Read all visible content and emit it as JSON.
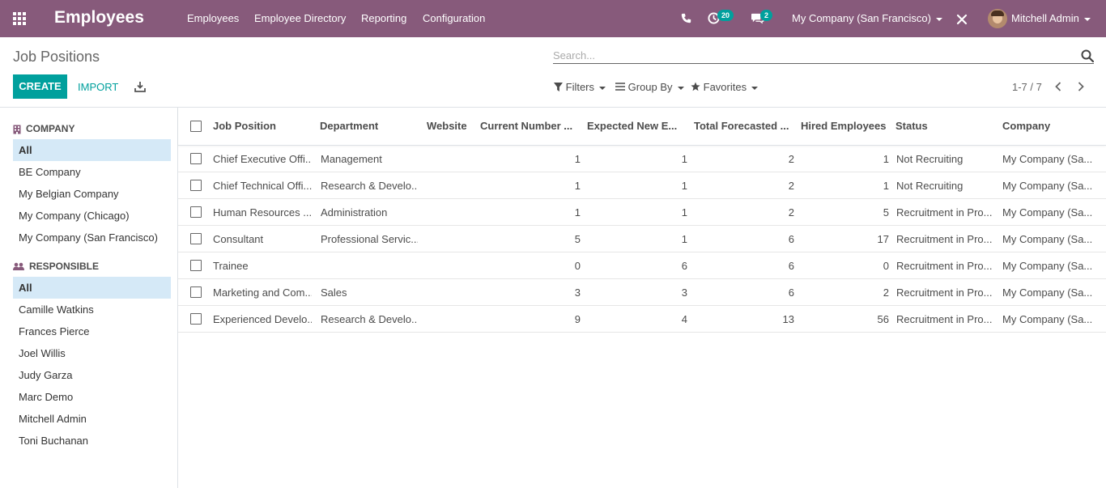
{
  "app": {
    "name": "Employees",
    "menu": [
      "Employees",
      "Employee Directory",
      "Reporting",
      "Configuration"
    ],
    "activity_count": "20",
    "message_count": "2",
    "company": "My Company (San Francisco)",
    "user": "Mitchell Admin",
    "colors": {
      "navbar": "#875a7b",
      "accent": "#00a09d"
    }
  },
  "control_panel": {
    "title": "Job Positions",
    "search_placeholder": "Search...",
    "create_label": "CREATE",
    "import_label": "IMPORT",
    "filters_label": "Filters",
    "groupby_label": "Group By",
    "favorites_label": "Favorites",
    "pager": "1-7 / 7"
  },
  "sidebar": {
    "company_header": "COMPANY",
    "companies": [
      "All",
      "BE Company",
      "My Belgian Company",
      "My Company (Chicago)",
      "My Company (San Francisco)"
    ],
    "responsible_header": "RESPONSIBLE",
    "responsibles": [
      "All",
      "Camille Watkins",
      "Frances Pierce",
      "Joel Willis",
      "Judy Garza",
      "Marc Demo",
      "Mitchell Admin",
      "Toni Buchanan"
    ]
  },
  "table": {
    "columns": [
      "Job Position",
      "Department",
      "Website",
      "Current Number ...",
      "Expected New E...",
      "Total Forecasted ...",
      "Hired Employees",
      "Status",
      "Company"
    ],
    "rows": [
      {
        "job": "Chief Executive Offi...",
        "dept": "Management",
        "website": "",
        "current": "1",
        "expected": "1",
        "total": "2",
        "hired": "1",
        "status": "Not Recruiting",
        "company": "My Company (Sa..."
      },
      {
        "job": "Chief Technical Offi...",
        "dept": "Research & Develo...",
        "website": "",
        "current": "1",
        "expected": "1",
        "total": "2",
        "hired": "1",
        "status": "Not Recruiting",
        "company": "My Company (Sa..."
      },
      {
        "job": "Human Resources ...",
        "dept": "Administration",
        "website": "",
        "current": "1",
        "expected": "1",
        "total": "2",
        "hired": "5",
        "status": "Recruitment in Pro...",
        "company": "My Company (Sa..."
      },
      {
        "job": "Consultant",
        "dept": "Professional Servic...",
        "website": "",
        "current": "5",
        "expected": "1",
        "total": "6",
        "hired": "17",
        "status": "Recruitment in Pro...",
        "company": "My Company (Sa..."
      },
      {
        "job": "Trainee",
        "dept": "",
        "website": "",
        "current": "0",
        "expected": "6",
        "total": "6",
        "hired": "0",
        "status": "Recruitment in Pro...",
        "company": "My Company (Sa..."
      },
      {
        "job": "Marketing and Com...",
        "dept": "Sales",
        "website": "",
        "current": "3",
        "expected": "3",
        "total": "6",
        "hired": "2",
        "status": "Recruitment in Pro...",
        "company": "My Company (Sa..."
      },
      {
        "job": "Experienced Develo...",
        "dept": "Research & Develo...",
        "website": "",
        "current": "9",
        "expected": "4",
        "total": "13",
        "hired": "56",
        "status": "Recruitment in Pro...",
        "company": "My Company (Sa..."
      }
    ]
  }
}
